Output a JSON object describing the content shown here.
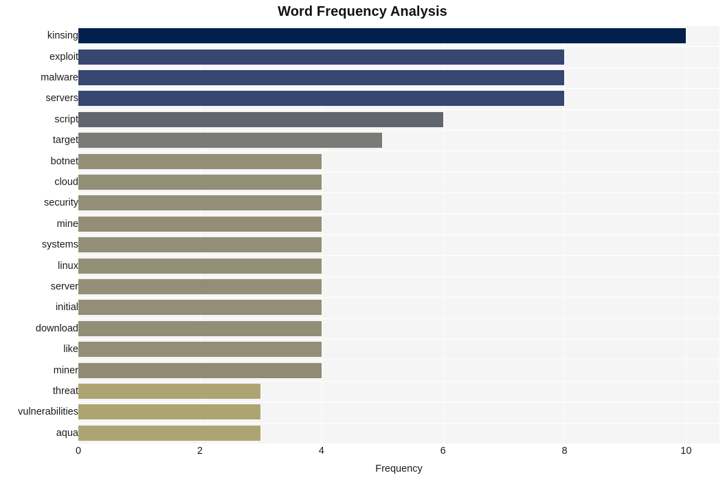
{
  "chart_data": {
    "type": "bar",
    "orientation": "horizontal",
    "title": "Word Frequency Analysis",
    "xlabel": "Frequency",
    "ylabel": "",
    "xlim": [
      0,
      10.55
    ],
    "xticks": [
      0,
      2,
      4,
      6,
      8,
      10
    ],
    "xtick_labels": [
      "0",
      "2",
      "4",
      "6",
      "8",
      "10"
    ],
    "grid": true,
    "grid_color": "#ffffff",
    "plot_background": "#f5f5f6",
    "page_background": "#ffffff",
    "legend": null,
    "categories": [
      "kinsing",
      "exploit",
      "malware",
      "servers",
      "script",
      "target",
      "botnet",
      "cloud",
      "security",
      "mine",
      "systems",
      "linux",
      "server",
      "initial",
      "download",
      "like",
      "miner",
      "threat",
      "vulnerabilities",
      "aqua"
    ],
    "values": [
      10,
      8,
      8,
      8,
      6,
      5,
      4,
      4,
      4,
      4,
      4,
      4,
      4,
      4,
      4,
      4,
      4,
      3,
      3,
      3
    ],
    "bar_colors": [
      "#03204c",
      "#374771",
      "#374771",
      "#374771",
      "#61656e",
      "#7a7a76",
      "#938e76",
      "#938e76",
      "#938e76",
      "#938e76",
      "#938e76",
      "#938e76",
      "#938e76",
      "#938e76",
      "#938e76",
      "#938e76",
      "#8f8b74",
      "#ada571",
      "#ada571",
      "#ada571"
    ],
    "bars": [
      {
        "label": "kinsing",
        "value": 10,
        "color": "#03204c"
      },
      {
        "label": "exploit",
        "value": 8,
        "color": "#374771"
      },
      {
        "label": "malware",
        "value": 8,
        "color": "#374771"
      },
      {
        "label": "servers",
        "value": 8,
        "color": "#374771"
      },
      {
        "label": "script",
        "value": 6,
        "color": "#61656e"
      },
      {
        "label": "target",
        "value": 5,
        "color": "#7a7a76"
      },
      {
        "label": "botnet",
        "value": 4,
        "color": "#938e76"
      },
      {
        "label": "cloud",
        "value": 4,
        "color": "#938e76"
      },
      {
        "label": "security",
        "value": 4,
        "color": "#938e76"
      },
      {
        "label": "mine",
        "value": 4,
        "color": "#938e76"
      },
      {
        "label": "systems",
        "value": 4,
        "color": "#938e76"
      },
      {
        "label": "linux",
        "value": 4,
        "color": "#938e76"
      },
      {
        "label": "server",
        "value": 4,
        "color": "#938e76"
      },
      {
        "label": "initial",
        "value": 4,
        "color": "#938e76"
      },
      {
        "label": "download",
        "value": 4,
        "color": "#938e76"
      },
      {
        "label": "like",
        "value": 4,
        "color": "#938e76"
      },
      {
        "label": "miner",
        "value": 4,
        "color": "#8f8b74"
      },
      {
        "label": "threat",
        "value": 3,
        "color": "#ada571"
      },
      {
        "label": "vulnerabilities",
        "value": 3,
        "color": "#ada571"
      },
      {
        "label": "aqua",
        "value": 3,
        "color": "#ada571"
      }
    ]
  }
}
